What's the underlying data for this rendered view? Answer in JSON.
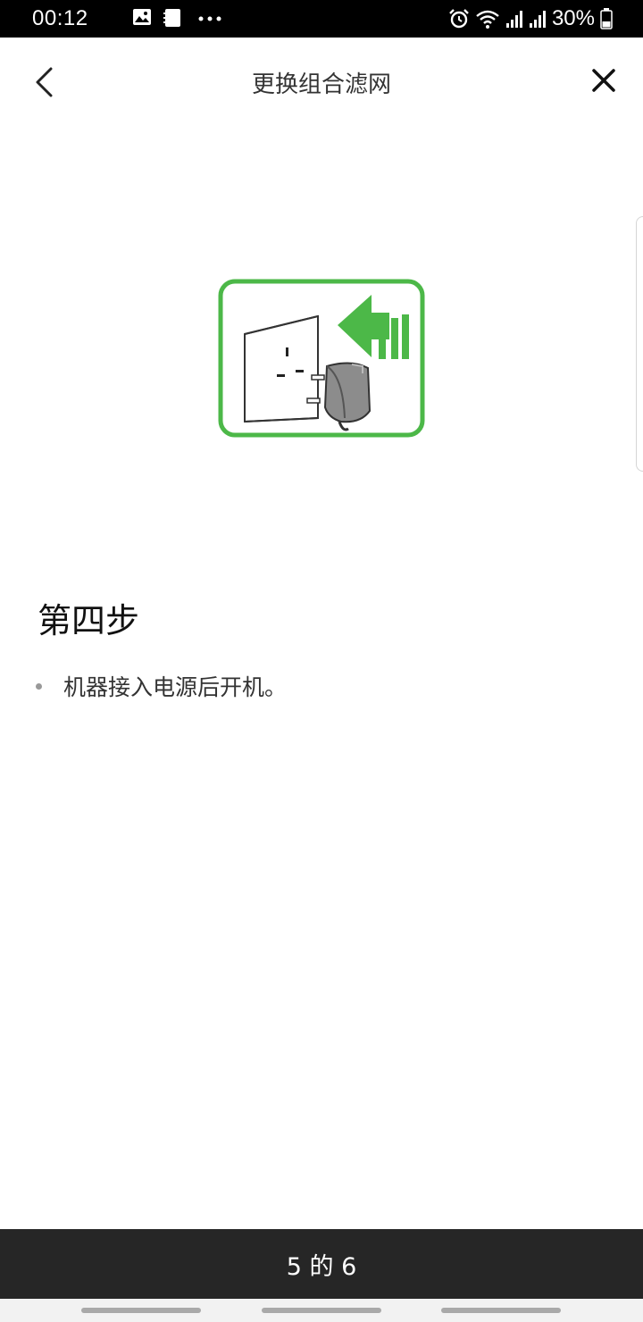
{
  "status_bar": {
    "time": "00:12",
    "battery": "30%",
    "notification_icons": [
      "image-icon",
      "document-icon",
      "more-dots-icon"
    ],
    "system_icons": [
      "alarm-icon",
      "wifi-icon",
      "signal-icon",
      "signal-icon",
      "battery-icon"
    ]
  },
  "header": {
    "title": "更换组合滤网",
    "back_icon": "chevron-left-icon",
    "close_icon": "close-icon"
  },
  "illustration": {
    "icon": "plug-into-socket-illustration",
    "accent_color": "#4cb848"
  },
  "step": {
    "title": "第四步",
    "items": [
      "机器接入电源后开机。"
    ]
  },
  "pager": {
    "text": "5 的 6"
  }
}
